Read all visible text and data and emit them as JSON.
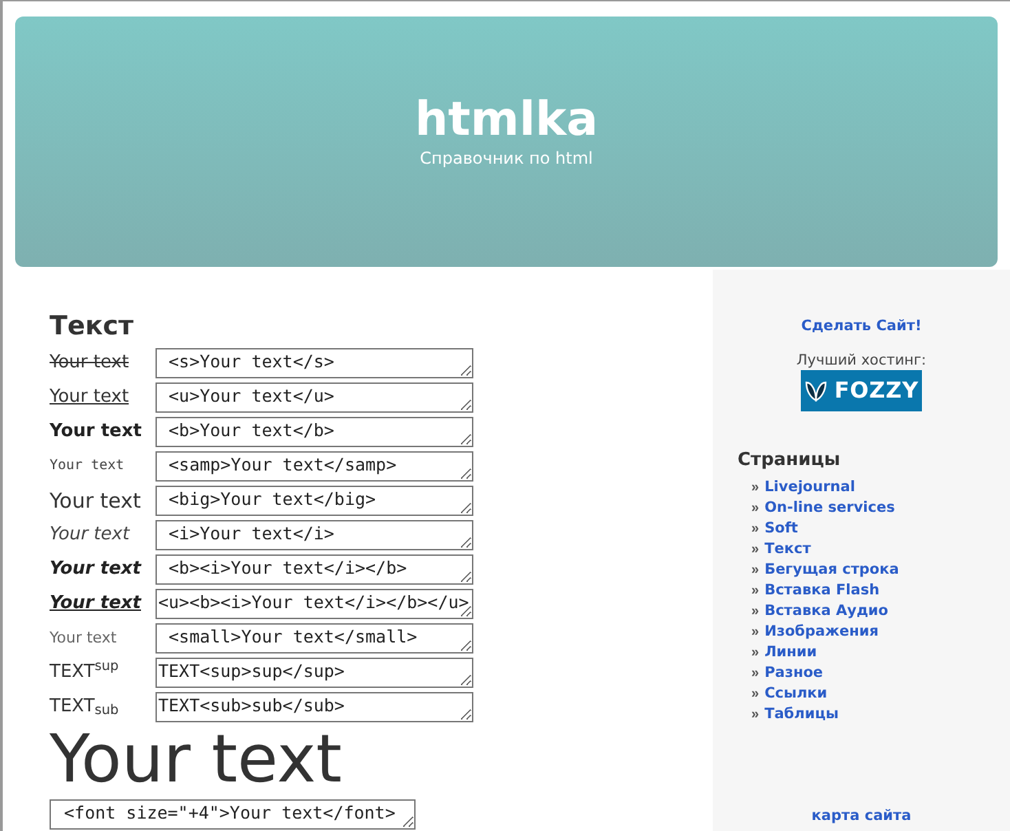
{
  "header": {
    "title": "htmlka",
    "subtitle": "Справочник по html"
  },
  "main": {
    "heading": "Текст",
    "examples": [
      {
        "kind": "strike",
        "sample": "Your text",
        "code": " <s>Your text</s>"
      },
      {
        "kind": "underline",
        "sample": "Your text",
        "code": " <u>Your text</u>"
      },
      {
        "kind": "bold",
        "sample": "Your text",
        "code": " <b>Your text</b>"
      },
      {
        "kind": "samp",
        "sample": "Your text",
        "code": " <samp>Your text</samp>"
      },
      {
        "kind": "big",
        "sample": "Your text",
        "code": " <big>Your text</big>"
      },
      {
        "kind": "italic",
        "sample": "Your text",
        "code": " <i>Your text</i>"
      },
      {
        "kind": "bold-italic",
        "sample": "Your text",
        "code": " <b><i>Your text</i></b>"
      },
      {
        "kind": "underline-bold-italic",
        "sample": "Your text",
        "code": "<u><b><i>Your text</i></b></u>"
      },
      {
        "kind": "small",
        "sample": "Your text",
        "code": " <small>Your text</small>"
      },
      {
        "kind": "plain",
        "sample": "TEXT$^{sup}$",
        "code": "TEXT<sup>sup</sup>"
      },
      {
        "kind": "plain",
        "sample": "TEXT$_{sub}$",
        "code": "TEXT<sub>sub</sub>"
      }
    ],
    "font_example": {
      "sample": "Your text",
      "code": " <font size=\"+4\">Your text</font>"
    }
  },
  "sidebar": {
    "make_site_link": "Сделать Сайт!",
    "hosting_label": "Лучший хостинг:",
    "hosting_logo": "FOZZY",
    "pages_heading": "Страницы",
    "pages": [
      {
        "bullet": "»",
        "label": "Livejournal"
      },
      {
        "bullet": "»",
        "label": "On-line services"
      },
      {
        "bullet": "»",
        "label": "Soft"
      },
      {
        "bullet": "»",
        "label": "Текст"
      },
      {
        "bullet": "»",
        "label": "Бегущая строка"
      },
      {
        "bullet": "»",
        "label": "Вставка Flash"
      },
      {
        "bullet": "»",
        "label": "Вставка Аудио"
      },
      {
        "bullet": "»",
        "label": "Изображения"
      },
      {
        "bullet": "»",
        "label": "Линии"
      },
      {
        "bullet": "»",
        "label": "Разное"
      },
      {
        "bullet": "»",
        "label": "Ссылки"
      },
      {
        "bullet": "»",
        "label": "Таблицы"
      }
    ],
    "sitemap_link": "карта сайта"
  }
}
